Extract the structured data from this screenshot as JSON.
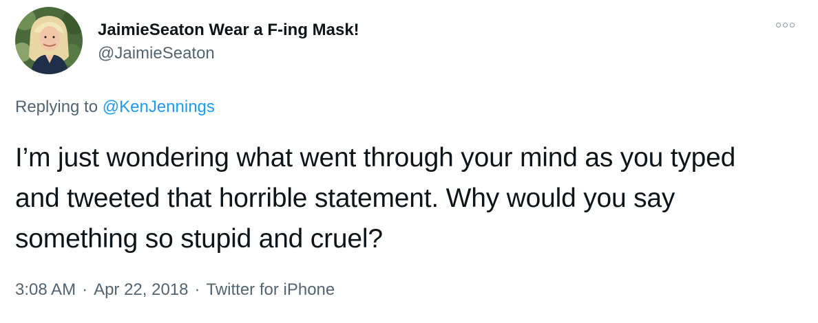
{
  "author": {
    "display_name": "JaimieSeaton Wear a F-ing Mask!",
    "handle": "@JaimieSeaton",
    "avatar_icon": "profile-photo"
  },
  "more_icon": "more-dots-icon",
  "reply_context": {
    "prefix": "Replying to",
    "mention": "@KenJennings"
  },
  "tweet": {
    "text": "I’m just wondering what went through your mind as you typed and tweeted that horrible statement. Why would you say something so stupid and cruel?"
  },
  "meta": {
    "time": "3:08 AM",
    "separator": "·",
    "date": "Apr 22, 2018",
    "source": "Twitter for iPhone"
  },
  "colors": {
    "primary_text": "#0f1419",
    "secondary_text": "#536471",
    "link": "#1d9bf0",
    "background": "#ffffff"
  }
}
